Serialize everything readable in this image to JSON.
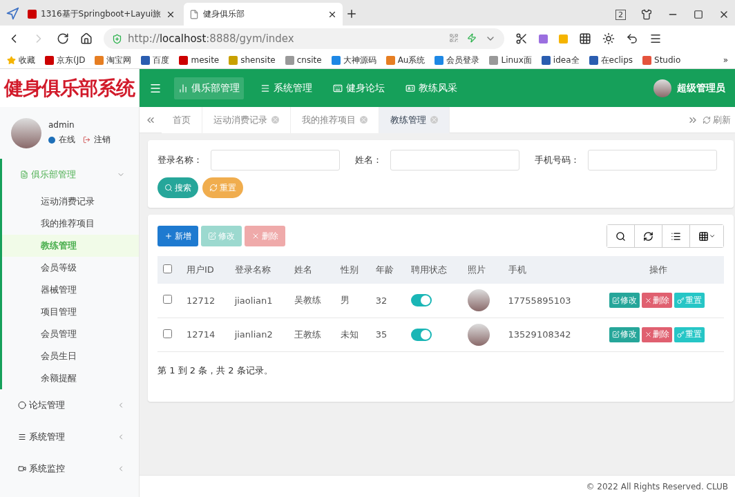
{
  "browser": {
    "tabs": [
      {
        "title": "1316基于Springboot+Layui旅",
        "selected": false
      },
      {
        "title": "健身俱乐部",
        "selected": true
      }
    ],
    "tab_counter": "2",
    "url": {
      "prefix": "http://",
      "host": "localhost",
      "rest": ":8888/gym/index"
    },
    "bookmarks": [
      "收藏",
      "京东(JD",
      "淘宝网",
      "百度",
      "mesite",
      "shensite",
      "cnsite",
      "大神源码",
      "Au系统",
      "会员登录",
      "Linux面",
      "idea全",
      "在eclips",
      "Studio"
    ],
    "more": "»"
  },
  "app": {
    "logo": "健身俱乐部系统",
    "top_nav": [
      {
        "label": "俱乐部管理",
        "selected": true
      },
      {
        "label": "系统管理",
        "selected": false
      },
      {
        "label": "健身论坛",
        "selected": false
      },
      {
        "label": "教练风采",
        "selected": false
      }
    ],
    "admin_name": "超级管理员"
  },
  "sidebar": {
    "user": {
      "name": "admin",
      "status": "在线",
      "logout": "注销"
    },
    "menu": [
      {
        "label": "俱乐部管理",
        "expanded": true,
        "children": [
          {
            "label": "运动消费记录",
            "selected": false
          },
          {
            "label": "我的推荐项目",
            "selected": false
          },
          {
            "label": "教练管理",
            "selected": true
          },
          {
            "label": "会员等级",
            "selected": false
          },
          {
            "label": "器械管理",
            "selected": false
          },
          {
            "label": "项目管理",
            "selected": false
          },
          {
            "label": "会员管理",
            "selected": false
          },
          {
            "label": "会员生日",
            "selected": false
          },
          {
            "label": "余额提醒",
            "selected": false
          }
        ]
      },
      {
        "label": "论坛管理",
        "expanded": false
      },
      {
        "label": "系统管理",
        "expanded": false
      },
      {
        "label": "系统监控",
        "expanded": false
      }
    ]
  },
  "page_tabs": [
    {
      "label": "首页",
      "selected": false,
      "closable": false
    },
    {
      "label": "运动消费记录",
      "selected": false,
      "closable": true
    },
    {
      "label": "我的推荐项目",
      "selected": false,
      "closable": true
    },
    {
      "label": "教练管理",
      "selected": true,
      "closable": true
    }
  ],
  "refresh": "刷新",
  "search": {
    "fields": [
      {
        "label": "登录名称："
      },
      {
        "label": "姓名："
      },
      {
        "label": "手机号码："
      }
    ],
    "search_button": "搜索",
    "reset_button": "重置"
  },
  "toolbar": [
    {
      "label": "新增",
      "kind": "add",
      "disabled": false
    },
    {
      "label": "修改",
      "kind": "edit",
      "disabled": true
    },
    {
      "label": "删除",
      "kind": "delete",
      "disabled": true
    }
  ],
  "table": {
    "all_checked": false,
    "columns": [
      "用户ID",
      "登录名称",
      "姓名",
      "性别",
      "年龄",
      "聘用状态",
      "照片",
      "手机",
      "操作"
    ],
    "rows": [
      {
        "checked": false,
        "cells": [
          "12712",
          "jiaolian1",
          "吴教练",
          "男",
          "32"
        ],
        "on": true,
        "phone": "17755895103",
        "actions": [
          {
            "label": "修改",
            "kind": "edit"
          },
          {
            "label": "删除",
            "kind": "delete"
          },
          {
            "label": "重置",
            "kind": "reset"
          }
        ]
      },
      {
        "checked": false,
        "cells": [
          "12714",
          "jianlian2",
          "王教练",
          "未知",
          "35"
        ],
        "on": true,
        "phone": "13529108342",
        "actions": [
          {
            "label": "修改",
            "kind": "edit"
          },
          {
            "label": "删除",
            "kind": "delete"
          },
          {
            "label": "重置",
            "kind": "reset"
          }
        ]
      }
    ]
  },
  "pagination": "第 1 到 2 条，共 2 条记录。",
  "footer": "© 2022 All Rights Reserved. CLUB"
}
